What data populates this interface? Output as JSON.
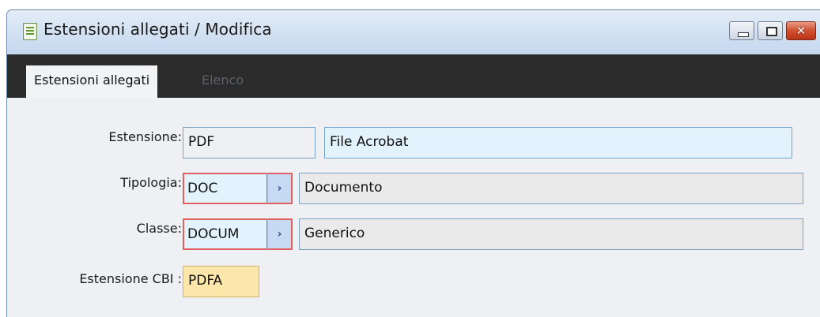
{
  "window": {
    "title": "Estensioni allegati / Modifica",
    "icon": "document-list-icon",
    "controls": [
      "minimize-icon",
      "maximize-icon",
      "close-icon"
    ]
  },
  "tabs": [
    {
      "label": "Estensioni allegati",
      "active": true
    },
    {
      "label": "Elenco",
      "active": false
    }
  ],
  "form": {
    "estensione": {
      "label": "Estensione:",
      "value": "PDF",
      "description": "File Acrobat"
    },
    "tipologia": {
      "label": "Tipologia:",
      "value": "DOC",
      "description": "Documento",
      "zoom": "›"
    },
    "classe": {
      "label": "Classe:",
      "value": "DOCUM",
      "description": "Generico",
      "zoom": "›"
    },
    "estensione_cbi": {
      "label": "Estensione CBI :",
      "value": "PDFA"
    }
  },
  "colors": {
    "titlebar": "#d4e2f2",
    "tabbar": "#2b2b2b",
    "editable_field": "#e2f3fd",
    "required_border": "#e06060",
    "cbi_field": "#fde6a9"
  }
}
